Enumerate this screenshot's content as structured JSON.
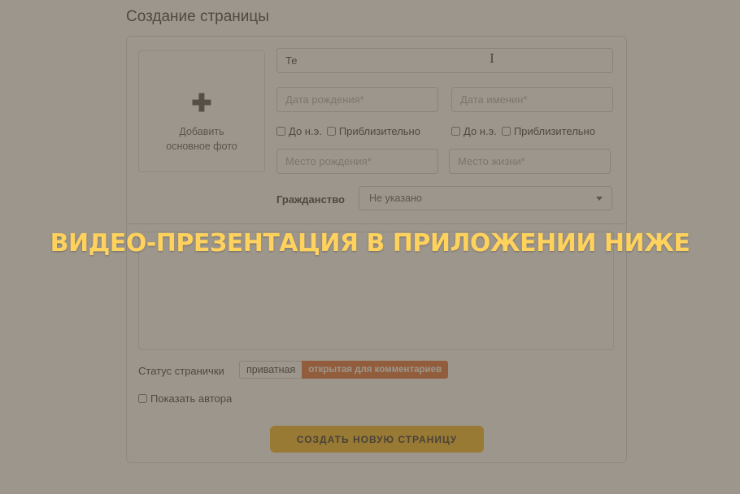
{
  "page": {
    "title": "Создание страницы"
  },
  "photo": {
    "plus": "✚",
    "label_line1": "Добавить",
    "label_line2": "основное фото"
  },
  "form": {
    "name_value": "Те",
    "birth_date_placeholder": "Дата рождения*",
    "name_day_placeholder": "Дата именин*",
    "bc_label": "До н.э.",
    "approx_label": "Приблизительно",
    "birth_place_placeholder": "Место рождения*",
    "residence_placeholder": "Место жизни*",
    "citizenship_label": "Гражданство",
    "citizenship_value": "Не указано"
  },
  "status": {
    "label": "Статус странички",
    "private_label": "приватная",
    "open_label": "открытая для комментариев",
    "selected": "открытая для комментариев"
  },
  "show_author": {
    "label": "Показать автора",
    "checked": false
  },
  "actions": {
    "create_label": "СОЗДАТЬ НОВУЮ СТРАНИЦУ"
  },
  "overlay": {
    "text": "ВИДЕО-ПРЕЗЕНТАЦИЯ В ПРИЛОЖЕНИИ НИЖЕ",
    "color": "#ffd25e"
  },
  "colors": {
    "accent": "#f3b61c",
    "selected_status": "#e46b2e"
  }
}
